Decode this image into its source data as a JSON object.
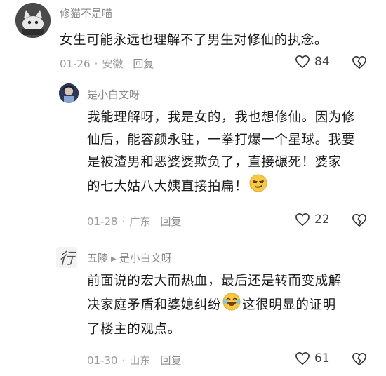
{
  "comments": [
    {
      "username": "修猫不是喵",
      "text": "女生可能永远也理解不了男生对修仙的执念。",
      "date": "01-26",
      "location": "安徽",
      "reply_label": "回复",
      "likes": "84",
      "avatar_icon": "cat-avatar-icon"
    },
    {
      "username": "是小白文呀",
      "text_lines": [
        "我能理解呀，我是女的，我也想修仙。因为修",
        "仙后，能容颜永驻，一拳打爆一个星球。我要",
        "是被渣男和恶婆婆欺负了，直接碾死！婆家",
        "的七大姑八大姨直接拍扁！"
      ],
      "date": "01-28",
      "location": "广东",
      "reply_label": "回复",
      "likes": "22",
      "avatar_icon": "anime-avatar-icon"
    },
    {
      "username": "五陵",
      "reply_to": "是小白文呀",
      "text_lines": [
        "前面说的宏大而热血，最后还是转而变成解",
        "决家庭矛盾和婆媳纠纷",
        "这很明显的证明",
        "了楼主的观点。"
      ],
      "date": "01-30",
      "location": "山东",
      "reply_label": "回复",
      "likes": "61",
      "avatar_icon": "calligraphy-avatar-icon",
      "avatar_char": "行"
    }
  ],
  "colors": {
    "meta": "#9b9b9b",
    "name": "#8a8a8a",
    "text": "#1b1b1b",
    "emoji": "#f7c843"
  }
}
